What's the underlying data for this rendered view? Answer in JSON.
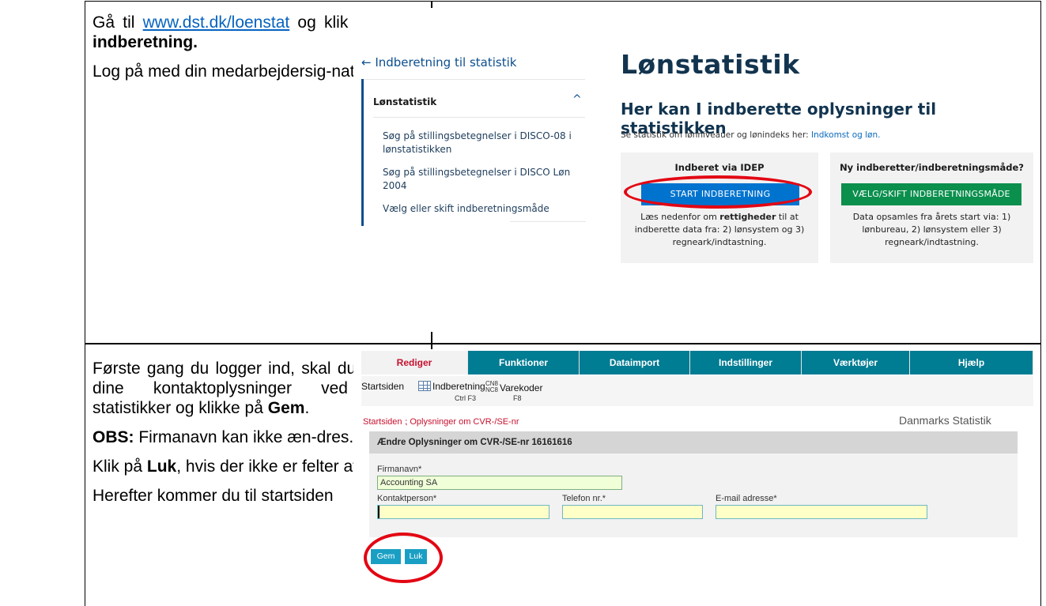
{
  "row1": {
    "line1_prefix": "Gå til ",
    "link": "www.dst.dk/loenstat",
    "line1_suffix": " og klik på ",
    "bold": "Start indberetning.",
    "para2": "Log på med din medarbejdersig-natur."
  },
  "row2": {
    "p1_text": "Første gang du logger ind, skal du indtaste dine kontaktoplysninger ved aktive statistikker og klikke på ",
    "p1_bold": "Gem",
    "p1_end": ".",
    "p2_bold": "OBS:",
    "p2_text": " Firmanavn kan ikke æn-dres.",
    "p3_pre": "Klik på ",
    "p3_bold": "Luk",
    "p3_post": ", hvis der ikke er felter at udfylde.",
    "p4": "Herefter kommer du til startsiden"
  },
  "dst": {
    "back_link": "← Indberetning til statistik",
    "side_heading": "Lønstatistik",
    "side_items": [
      "Søg på stillingsbetegnelser i DISCO-08 i lønstatistikken",
      "Søg på stillingsbetegnelser i DISCO Løn 2004",
      "Vælg eller skift indberetningsmåde"
    ],
    "title": "Lønstatistik",
    "subtitle": "Her kan I indberette oplysninger til statistikken",
    "note_prefix": "Se statistik om lønniveauer og lønindeks her: ",
    "note_link": "Indkomst og løn.",
    "box1_title": "Indberet via IDEP",
    "box1_button": "START INDBERETNING",
    "box1_text_a": "Læs nedenfor om ",
    "box1_text_bold": "rettigheder",
    "box1_text_b": " til at indberette data fra: 2) lønsystem og 3) regneark/indtastning.",
    "box2_title": "Ny indberetter/indberetningsmåde?",
    "box2_button": "VÆLG/SKIFT INDBERETNINGSMÅDE",
    "box2_text": "Data opsamles fra årets start via: 1) lønbureau, 2) lønsystem eller 3) regneark/indtastning."
  },
  "idep": {
    "menu": [
      "Rediger",
      "Funktioner",
      "Dataimport",
      "Indstillinger",
      "Værktøjer",
      "Hjælp"
    ],
    "toolbar_start": "Startsiden",
    "toolbar_indb": "Indberetning",
    "toolbar_indb_key": "Ctrl F3",
    "toolbar_vare_icon": "CN8 NC8",
    "toolbar_vare": "Varekoder",
    "toolbar_vare_key": "F8",
    "breadcrumb": "Startsiden ⁏ Oplysninger om CVR-/SE-nr",
    "org": "Danmarks Statistik",
    "form_heading": "Ændre Oplysninger om CVR-/SE-nr 16161616",
    "firm_label": "Firmanavn*",
    "firm_value": "Accounting SA",
    "contact_label": "Kontaktperson*",
    "phone_label": "Telefon nr.*",
    "email_label": "E-mail adresse*",
    "save_label": "Gem",
    "close_label": "Luk"
  },
  "colors": {
    "menubar": "#007c93",
    "start_button": "#0073cf",
    "choose_button": "#0a8f4d",
    "highlight_ring": "#e30613"
  }
}
